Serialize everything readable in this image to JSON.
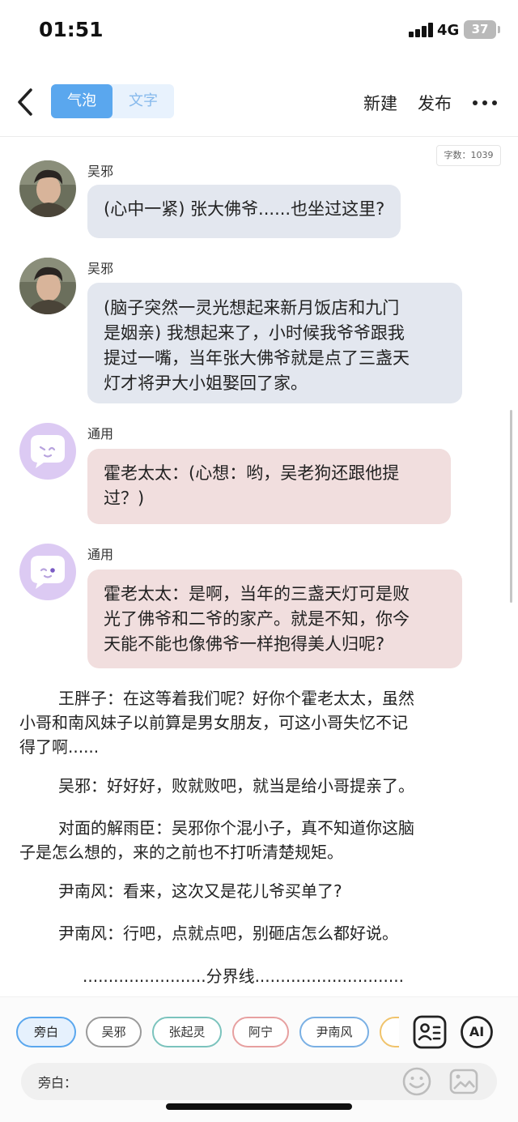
{
  "status_bar": {
    "time": "01:51",
    "network": "4G",
    "battery": "37"
  },
  "nav": {
    "tabs": [
      {
        "label": "气泡",
        "active": true
      },
      {
        "label": "文字",
        "active": false
      }
    ],
    "new_label": "新建",
    "publish_label": "发布"
  },
  "word_count": "字数：1039",
  "messages": [
    {
      "speaker": "吴邪",
      "avatar": "character-photo",
      "text": "(心中一紧) 张大佛爷......也坐过这里?"
    },
    {
      "speaker": "吴邪",
      "avatar": "character-photo",
      "lines": [
        "(脑子突然一灵光想起来新月饭店和九门",
        "是姻亲) 我想起来了，小时候我爷爷跟我",
        "提过一嘴，当年张大佛爷就是点了三盏天",
        "灯才将尹大小姐娶回了家。"
      ]
    },
    {
      "speaker": "通用",
      "avatar": "chat-bubble-icon",
      "lines": [
        "霍老太太：(心想：哟，吴老狗还跟他提",
        "过？)"
      ]
    },
    {
      "speaker": "通用",
      "avatar": "chat-bubble-icon",
      "lines": [
        "霍老太太：是啊，当年的三盏天灯可是败",
        "光了佛爷和二爷的家产。就是不知，你今",
        "天能不能也像佛爷一样抱得美人归呢?"
      ]
    }
  ],
  "narration": [
    [
      "王胖子：在这等着我们呢？好你个霍老太太，虽然",
      "小哥和南风妹子以前算是男女朋友，可这小哥失忆不记",
      "得了啊......"
    ],
    [
      "吴邪：好好好，败就败吧，就当是给小哥提亲了。"
    ],
    [
      "对面的解雨臣：吴邪你个混小子，真不知道你这脑",
      "子是怎么想的，来的之前也不打听清楚规矩。"
    ],
    [
      "尹南风：看来，这次又是花儿爷买单了?"
    ],
    [
      "尹南风：行吧，点就点吧，别砸店怎么都好说。"
    ],
    [
      "........................分界线............................."
    ]
  ],
  "characters": [
    {
      "name": "旁白",
      "selected": true,
      "color": "#5aa7ee"
    },
    {
      "name": "吴邪",
      "selected": false,
      "color": "#9a9a9a"
    },
    {
      "name": "张起灵",
      "selected": false,
      "color": "#7bc3bd"
    },
    {
      "name": "阿宁",
      "selected": false,
      "color": "#e7a0a0"
    },
    {
      "name": "尹南风",
      "selected": false,
      "color": "#7ab0e4"
    },
    {
      "name": "…",
      "selected": false,
      "color": "#f0c36b"
    }
  ],
  "tools": {
    "ai_label": "AI"
  },
  "input": {
    "label": "旁白：",
    "value": ""
  },
  "colors": {
    "accent": "#5aa7ee",
    "bubble_blue": "#e3e7ef",
    "bubble_pink": "#f1dede",
    "generic_avatar": "#dccaf3"
  }
}
